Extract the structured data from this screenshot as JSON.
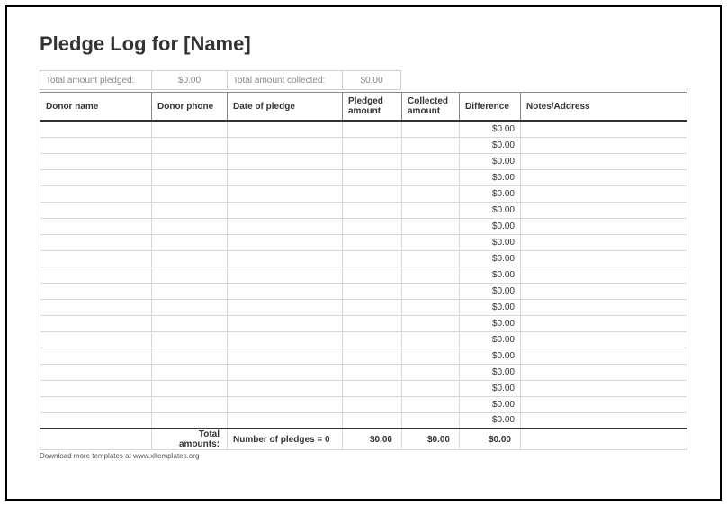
{
  "title": "Pledge Log for [Name]",
  "summary": {
    "label_pledged": "Total amount pledged:",
    "value_pledged": "$0.00",
    "label_collected": "Total amount collected:",
    "value_collected": "$0.00"
  },
  "headers": {
    "donor_name": "Donor name",
    "donor_phone": "Donor phone",
    "date_of_pledge": "Date of pledge",
    "pledged_amount": "Pledged amount",
    "collected_amount": "Collected amount",
    "difference": "Difference",
    "notes": "Notes/Address"
  },
  "rows": [
    {
      "difference": "$0.00"
    },
    {
      "difference": "$0.00"
    },
    {
      "difference": "$0.00"
    },
    {
      "difference": "$0.00"
    },
    {
      "difference": "$0.00"
    },
    {
      "difference": "$0.00"
    },
    {
      "difference": "$0.00"
    },
    {
      "difference": "$0.00"
    },
    {
      "difference": "$0.00"
    },
    {
      "difference": "$0.00"
    },
    {
      "difference": "$0.00"
    },
    {
      "difference": "$0.00"
    },
    {
      "difference": "$0.00"
    },
    {
      "difference": "$0.00"
    },
    {
      "difference": "$0.00"
    },
    {
      "difference": "$0.00"
    },
    {
      "difference": "$0.00"
    },
    {
      "difference": "$0.00"
    },
    {
      "difference": "$0.00"
    }
  ],
  "totals": {
    "label": "Total amounts:",
    "pledge_count": "Number of pledges = 0",
    "pledged": "$0.00",
    "collected": "$0.00",
    "difference": "$0.00"
  },
  "footer": "Download more templates at www.xltemplates.org"
}
